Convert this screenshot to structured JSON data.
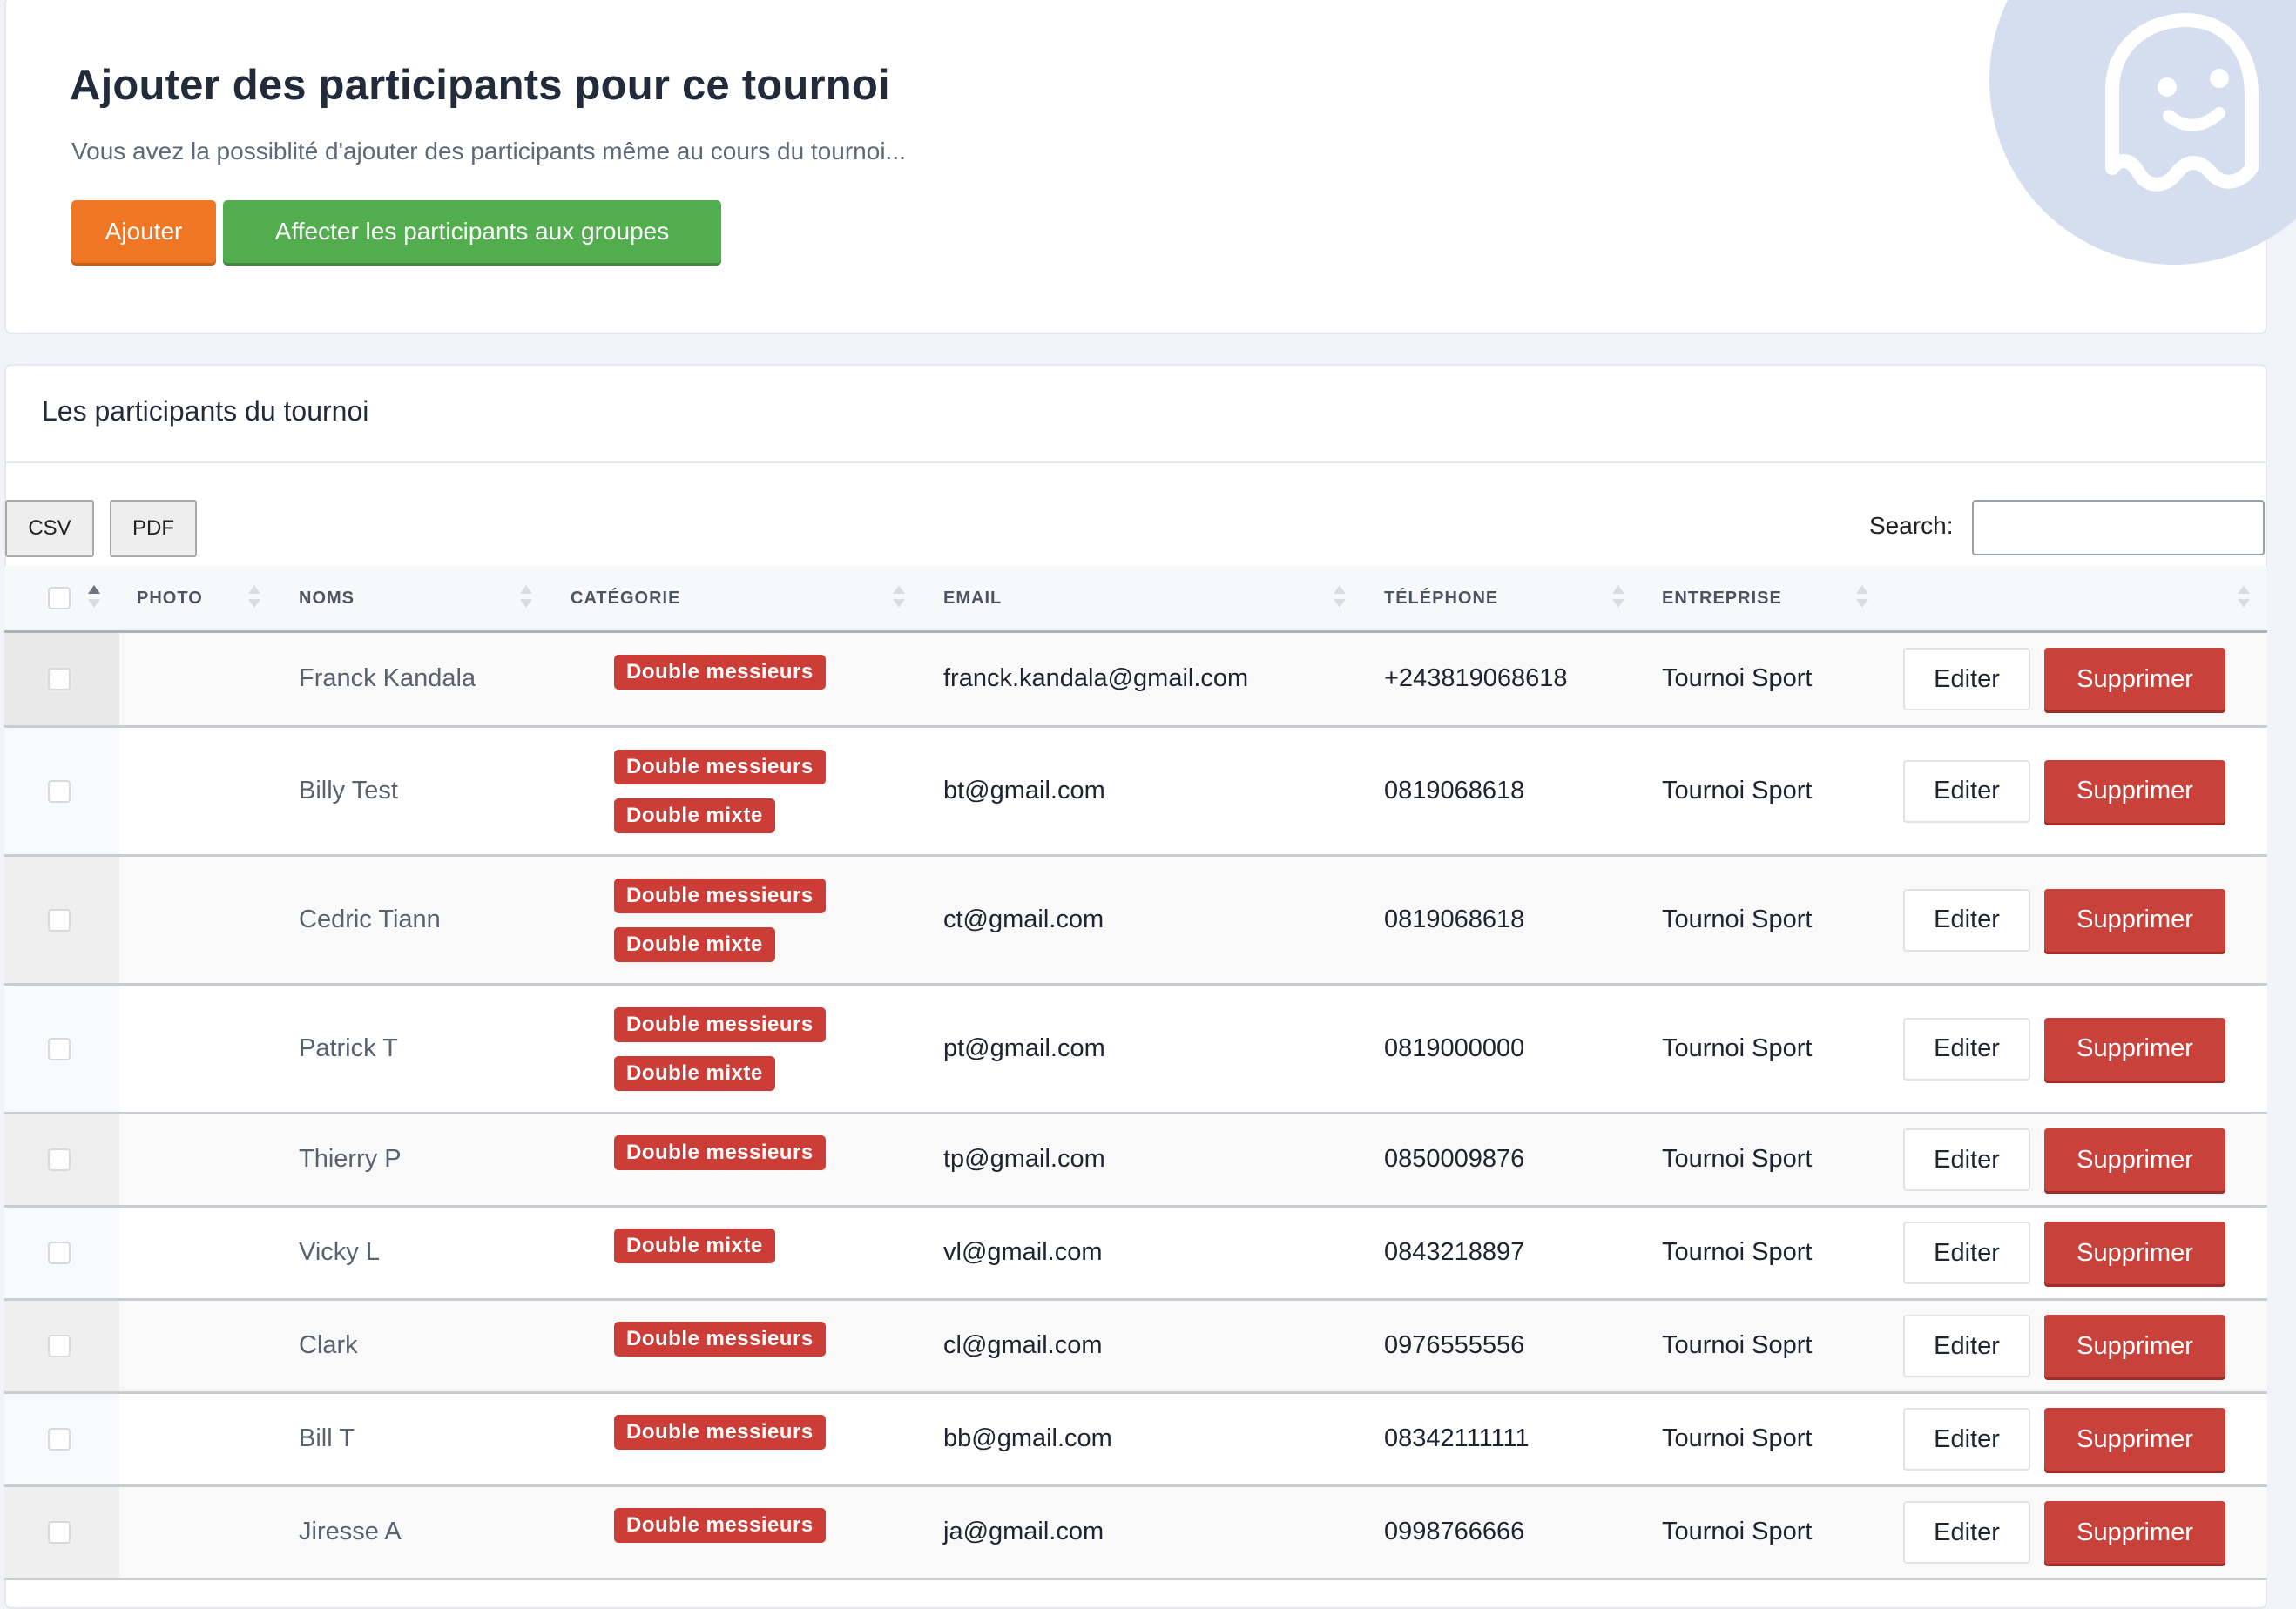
{
  "header": {
    "title": "Ajouter des participants pour ce tournoi",
    "subtitle": "Vous avez la possiblité d'ajouter des participants même au cours du tournoi...",
    "add_button": "Ajouter",
    "assign_button": "Affecter les participants aux groupes",
    "illustration_icon": "ghost-icon"
  },
  "list": {
    "title": "Les participants du tournoi",
    "export": {
      "csv": "CSV",
      "pdf": "PDF"
    },
    "search": {
      "label": "Search:",
      "value": "",
      "placeholder": ""
    },
    "columns": [
      "PHOTO",
      "NOMS",
      "CATÉGORIE",
      "EMAIL",
      "TÉLÉPHONE",
      "ENTREPRISE"
    ],
    "sorted_column": "select",
    "actions": {
      "edit": "Editer",
      "delete": "Supprimer"
    },
    "rows": [
      {
        "name": "Franck Kandala",
        "categories": [
          "Double messieurs"
        ],
        "email": "franck.kandala@gmail.com",
        "phone": "+243819068618",
        "company": "Tournoi Sport"
      },
      {
        "name": "Billy Test",
        "categories": [
          "Double messieurs",
          "Double mixte"
        ],
        "email": "bt@gmail.com",
        "phone": "0819068618",
        "company": "Tournoi Sport"
      },
      {
        "name": "Cedric Tiann",
        "categories": [
          "Double messieurs",
          "Double mixte"
        ],
        "email": "ct@gmail.com",
        "phone": "0819068618",
        "company": "Tournoi Sport"
      },
      {
        "name": "Patrick T",
        "categories": [
          "Double messieurs",
          "Double mixte"
        ],
        "email": "pt@gmail.com",
        "phone": "0819000000",
        "company": "Tournoi Sport"
      },
      {
        "name": "Thierry P",
        "categories": [
          "Double messieurs"
        ],
        "email": "tp@gmail.com",
        "phone": "0850009876",
        "company": "Tournoi Sport"
      },
      {
        "name": "Vicky L",
        "categories": [
          "Double mixte"
        ],
        "email": "vl@gmail.com",
        "phone": "0843218897",
        "company": "Tournoi Sport"
      },
      {
        "name": "Clark",
        "categories": [
          "Double messieurs"
        ],
        "email": "cl@gmail.com",
        "phone": "0976555556",
        "company": "Tournoi Soprt"
      },
      {
        "name": "Bill T",
        "categories": [
          "Double messieurs"
        ],
        "email": "bb@gmail.com",
        "phone": "08342111111",
        "company": "Tournoi Sport"
      },
      {
        "name": "Jiresse A",
        "categories": [
          "Double messieurs"
        ],
        "email": "ja@gmail.com",
        "phone": "0998766666",
        "company": "Tournoi Sport"
      }
    ]
  },
  "colors": {
    "add_button": "#ee7624",
    "assign_button": "#52ad4f",
    "delete_button": "#c8413b",
    "badge": "#cc3d37",
    "illustration": "#d4deef"
  }
}
